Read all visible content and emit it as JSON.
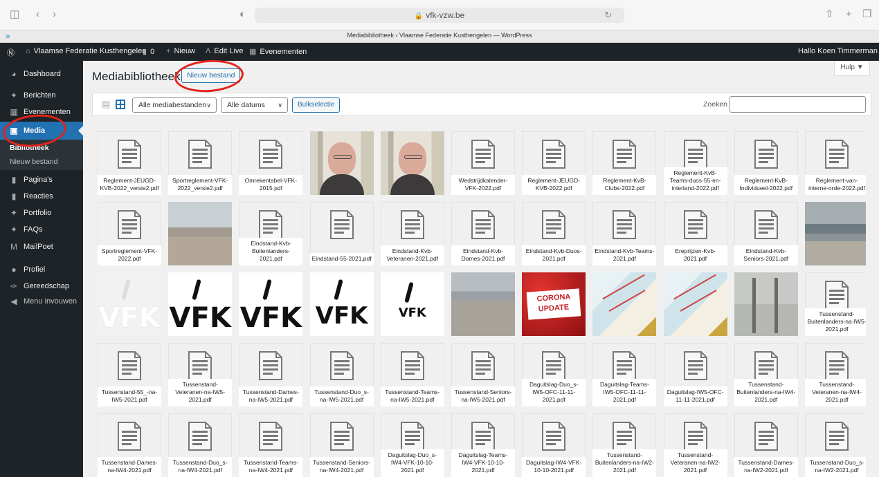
{
  "browser": {
    "url": "vfk-vzw.be",
    "tab_title": "Mediabibliotheek ‹ Vlaamse Federatie Kusthengelen — WordPress"
  },
  "adminbar": {
    "site_name": "Vlaamse Federatie Kusthengelen",
    "comments_count": "0",
    "new_label": "Nieuw",
    "edit_live_label": "Edit Live",
    "events_label": "Evenementen",
    "greeting": "Hallo Koen Timmerman"
  },
  "sidebar": {
    "items": [
      {
        "label": "Dashboard",
        "icon": "dashboard-icon"
      },
      {
        "label": "Berichten",
        "icon": "pin-icon"
      },
      {
        "label": "Evenementen",
        "icon": "calendar-icon"
      },
      {
        "label": "Media",
        "icon": "media-icon"
      },
      {
        "label": "Pagina's",
        "icon": "pages-icon"
      },
      {
        "label": "Reacties",
        "icon": "comments-icon"
      },
      {
        "label": "Portfolio",
        "icon": "pin-icon"
      },
      {
        "label": "FAQs",
        "icon": "pin-icon"
      },
      {
        "label": "MailPoet",
        "icon": "mailpoet-icon"
      },
      {
        "label": "Profiel",
        "icon": "user-icon"
      },
      {
        "label": "Gereedschap",
        "icon": "wrench-icon"
      },
      {
        "label": "Menu invouwen",
        "icon": "collapse-icon"
      }
    ],
    "submenu": [
      "Bibliotheek",
      "Nieuw bestand"
    ]
  },
  "main": {
    "title": "Mediabibliotheek",
    "new_file_button": "Nieuw bestand",
    "help_label": "Hulp ▼",
    "filter_type": "Alle mediabestanden",
    "filter_date": "Alle datums",
    "bulk_select": "Bulkselectie",
    "search_label": "Zoeken",
    "search_value": ""
  },
  "media_items": [
    {
      "type": "pdf",
      "name": "Reglement-JEUGD-KVB-2022_versie2.pdf"
    },
    {
      "type": "pdf",
      "name": "Sportreglement-VFK-2022_versie2.pdf"
    },
    {
      "type": "pdf",
      "name": "Omrekentabel-VFK-2015.pdf"
    },
    {
      "type": "image",
      "kind": "selfie"
    },
    {
      "type": "image",
      "kind": "selfie"
    },
    {
      "type": "pdf",
      "name": "Wedstrijdkalender-VFK-2022.pdf"
    },
    {
      "type": "pdf",
      "name": "Reglement-JEUGD-KVB-2022.pdf"
    },
    {
      "type": "pdf",
      "name": "Reglement-KvB-Clubs-2022.pdf"
    },
    {
      "type": "pdf",
      "name": "Reglement-KvB-Teams-duos-55-en-interland-2022.pdf"
    },
    {
      "type": "pdf",
      "name": "Reglement-KvB-Individueel-2022.pdf"
    },
    {
      "type": "pdf",
      "name": "Reglement-van-interne-orde-2022.pdf"
    },
    {
      "type": "pdf",
      "name": "Sportreglement-VFK-2022.pdf"
    },
    {
      "type": "image",
      "kind": "beach"
    },
    {
      "type": "pdf",
      "name": "Eindstand-Kvb-Buitenlanders-2021.pdf"
    },
    {
      "type": "pdf",
      "name": "Eindstand-55-2021.pdf"
    },
    {
      "type": "pdf",
      "name": "Eindstand-Kvb-Veteranen-2021.pdf"
    },
    {
      "type": "pdf",
      "name": "Eindstand-Kvb-Dames-2021.pdf"
    },
    {
      "type": "pdf",
      "name": "Eindstand-Kvb-Duos-2021.pdf"
    },
    {
      "type": "pdf",
      "name": "Eindstand-Kvb-Teams-2021.pdf"
    },
    {
      "type": "pdf",
      "name": "Ereprijzen-Kvb-2021.pdf"
    },
    {
      "type": "pdf",
      "name": "Eindstand-Kvb-Seniors-2021.pdf"
    },
    {
      "type": "image",
      "kind": "sea"
    },
    {
      "type": "image",
      "kind": "logo-faded",
      "logo_text": "VFK"
    },
    {
      "type": "image",
      "kind": "logo",
      "logo_text": "VFK"
    },
    {
      "type": "image",
      "kind": "logo",
      "logo_text": "VFK"
    },
    {
      "type": "image",
      "kind": "logo-small",
      "logo_text": "VFK"
    },
    {
      "type": "image",
      "kind": "logo-tiny",
      "logo_text": "VFK"
    },
    {
      "type": "image",
      "kind": "shore"
    },
    {
      "type": "image",
      "kind": "corona",
      "line1": "CORONA",
      "line2": "UPDATE"
    },
    {
      "type": "image",
      "kind": "map"
    },
    {
      "type": "image",
      "kind": "map"
    },
    {
      "type": "image",
      "kind": "poles"
    },
    {
      "type": "pdf",
      "name": "Tussenstand-Buitenlanders-na-IW5-2021.pdf"
    },
    {
      "type": "pdf",
      "name": "Tussenstand-55_-na-IW5-2021.pdf"
    },
    {
      "type": "pdf",
      "name": "Tussenstand-Veteranen-na-IW5-2021.pdf"
    },
    {
      "type": "pdf",
      "name": "Tussenstand-Dames-na-IW5-2021.pdf"
    },
    {
      "type": "pdf",
      "name": "Tussenstand-Duo_s-na-IW5-2021.pdf"
    },
    {
      "type": "pdf",
      "name": "Tussenstand-Teams-na-IW5-2021.pdf"
    },
    {
      "type": "pdf",
      "name": "Tussenstand-Seniors-na-IW5-2021.pdf"
    },
    {
      "type": "pdf",
      "name": "Daguitslag-Duo_s-IW5-OFC-11-11-2021.pdf"
    },
    {
      "type": "pdf",
      "name": "Daguitslag-Teams-IW5-OFC-11-11-2021.pdf"
    },
    {
      "type": "pdf",
      "name": "Daguitslag-IW5-OFC-11-11-2021.pdf"
    },
    {
      "type": "pdf",
      "name": "Tussenstand-Buitenlanders-na-IW4-2021.pdf"
    },
    {
      "type": "pdf",
      "name": "Tussenstand-Veteranen-na-IW4-2021.pdf"
    },
    {
      "type": "pdf",
      "name": "Tussenstand-Dames-na-IW4-2021.pdf"
    },
    {
      "type": "pdf",
      "name": "Tussenstand-Duo_s-na-IW4-2021.pdf"
    },
    {
      "type": "pdf",
      "name": "Tussenstand-Teams-na-IW4-2021.pdf"
    },
    {
      "type": "pdf",
      "name": "Tussenstand-Seniors-na-IW4-2021.pdf"
    },
    {
      "type": "pdf",
      "name": "Daguitslag-Duo_s-IW4-VFK-10-10-2021.pdf"
    },
    {
      "type": "pdf",
      "name": "Daguitslag-Teams-IW4-VFK-10-10-2021.pdf"
    },
    {
      "type": "pdf",
      "name": "Daguitslag-IW4-VFK-10-10-2021.pdf"
    },
    {
      "type": "pdf",
      "name": "Tussenstand-Buitenlanders-na-IW2-2021.pdf"
    },
    {
      "type": "pdf",
      "name": "Tussenstand-Veteranen-na-IW2-2021.pdf"
    },
    {
      "type": "pdf",
      "name": "Tussenstand-Dames-na-IW2-2021.pdf"
    },
    {
      "type": "pdf",
      "name": "Tussenstand-Duo_s-na-IW2-2021.pdf"
    }
  ],
  "colors": {
    "accent": "#2271b1",
    "adminbar": "#1d2327",
    "annotation": "#e3231b"
  }
}
